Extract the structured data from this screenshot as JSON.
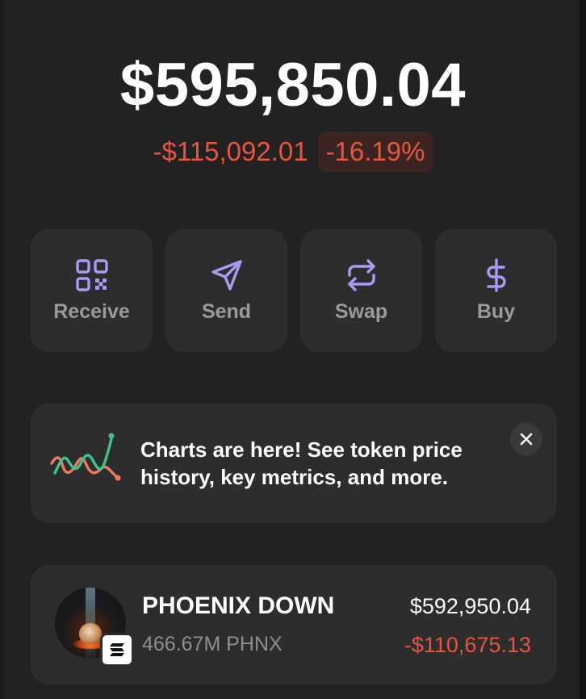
{
  "wallet": {
    "balance": "$595,850.04",
    "change_amount": "-$115,092.01",
    "change_percent": "-16.19%"
  },
  "actions": [
    {
      "label": "Receive",
      "icon": "qr-code-icon"
    },
    {
      "label": "Send",
      "icon": "send-icon"
    },
    {
      "label": "Swap",
      "icon": "swap-icon"
    },
    {
      "label": "Buy",
      "icon": "dollar-icon"
    }
  ],
  "banner": {
    "message": "Charts are here! See token price history, key metrics, and more.",
    "icon": "chart-icon",
    "close_icon": "close-icon"
  },
  "tokens": [
    {
      "name": "PHOENIX DOWN",
      "amount": "466.67M PHNX",
      "value": "$592,950.04",
      "change": "-$110,675.13",
      "chain_icon": "solana-icon"
    }
  ],
  "colors": {
    "background": "#222222",
    "card": "#2d2d2d",
    "accent": "#a99bf5",
    "negative": "#e8553f",
    "negative_badge_bg": "#3b2522",
    "muted_text": "#9a9a9a"
  }
}
